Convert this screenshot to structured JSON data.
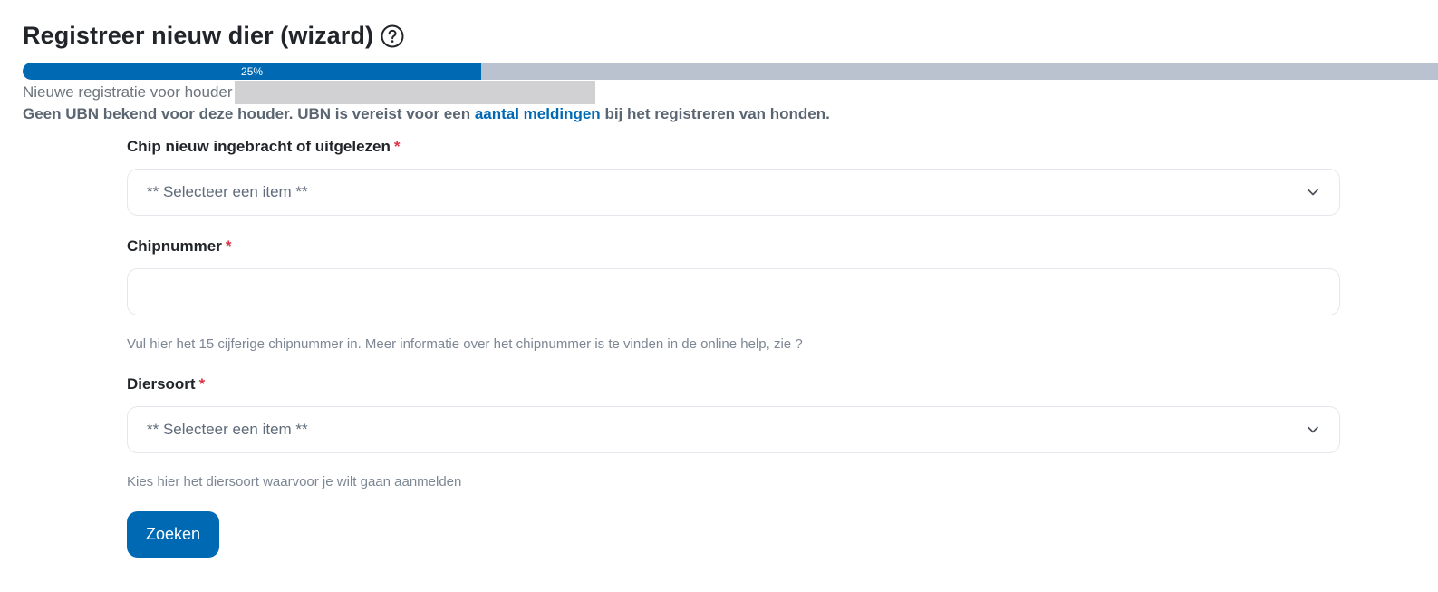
{
  "header": {
    "title": "Registreer nieuw dier (wizard)",
    "help_icon": "question-circle-icon"
  },
  "progress": {
    "label": "25%",
    "value": 25
  },
  "info": {
    "holder_prefix": "Nieuwe registratie voor houder",
    "ubn_text_before": "Geen UBN bekend voor deze houder. UBN is vereist voor een",
    "ubn_link": "aantal meldingen",
    "ubn_text_after": "bij het registreren van honden."
  },
  "form": {
    "chip_inserted": {
      "label": "Chip nieuw ingebracht of uitgelezen",
      "required_mark": "*",
      "selected": "** Selecteer een item **"
    },
    "chip_number": {
      "label": "Chipnummer",
      "required_mark": "*",
      "value": "",
      "hint": "Vul hier het 15 cijferige chipnummer in. Meer informatie over het chipnummer is te vinden in de online help, zie ?"
    },
    "species": {
      "label": "Diersoort",
      "required_mark": "*",
      "selected": "** Selecteer een item **",
      "hint": "Kies hier het diersoort waarvoor je wilt gaan aanmelden"
    },
    "submit_label": "Zoeken"
  },
  "colors": {
    "accent": "#0069b4",
    "progress_track": "#b9c2ce",
    "required": "#dc3545"
  }
}
